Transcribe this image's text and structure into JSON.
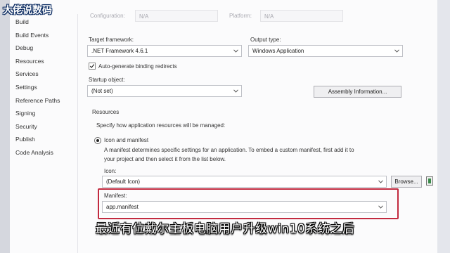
{
  "watermark": "大佬说数码",
  "topbar": {
    "configuration_label": "Configuration:",
    "configuration_value": "N/A",
    "platform_label": "Platform:",
    "platform_value": "N/A"
  },
  "sidebar": {
    "items": [
      {
        "label": "Build"
      },
      {
        "label": "Build Events"
      },
      {
        "label": "Debug"
      },
      {
        "label": "Resources"
      },
      {
        "label": "Services"
      },
      {
        "label": "Settings"
      },
      {
        "label": "Reference Paths"
      },
      {
        "label": "Signing"
      },
      {
        "label": "Security"
      },
      {
        "label": "Publish"
      },
      {
        "label": "Code Analysis"
      }
    ]
  },
  "main": {
    "target_framework_label": "Target framework:",
    "target_framework_value": ".NET Framework 4.6.1",
    "output_type_label": "Output type:",
    "output_type_value": "Windows Application",
    "auto_binding_label": "Auto-generate binding redirects",
    "auto_binding_checked": true,
    "startup_object_label": "Startup object:",
    "startup_object_value": "(Not set)",
    "assembly_info_button": "Assembly Information...",
    "resources_heading": "Resources",
    "resources_desc": "Specify how application resources will be managed:",
    "icon_manifest_label": "Icon and manifest",
    "icon_manifest_desc_line1": "A manifest determines specific settings for an application. To embed a custom manifest, first add it to",
    "icon_manifest_desc_line2": "your project and then select it from the list below.",
    "icon_label": "Icon:",
    "icon_value": "(Default Icon)",
    "browse_button": "Browse...",
    "manifest_label": "Manifest:",
    "manifest_value": "app.manifest"
  },
  "subtitle": "最近有位戴尔主板电脑用户升级win10系统之后",
  "colors": {
    "highlight": "#c22a3f",
    "background": "#fbfbfc"
  }
}
